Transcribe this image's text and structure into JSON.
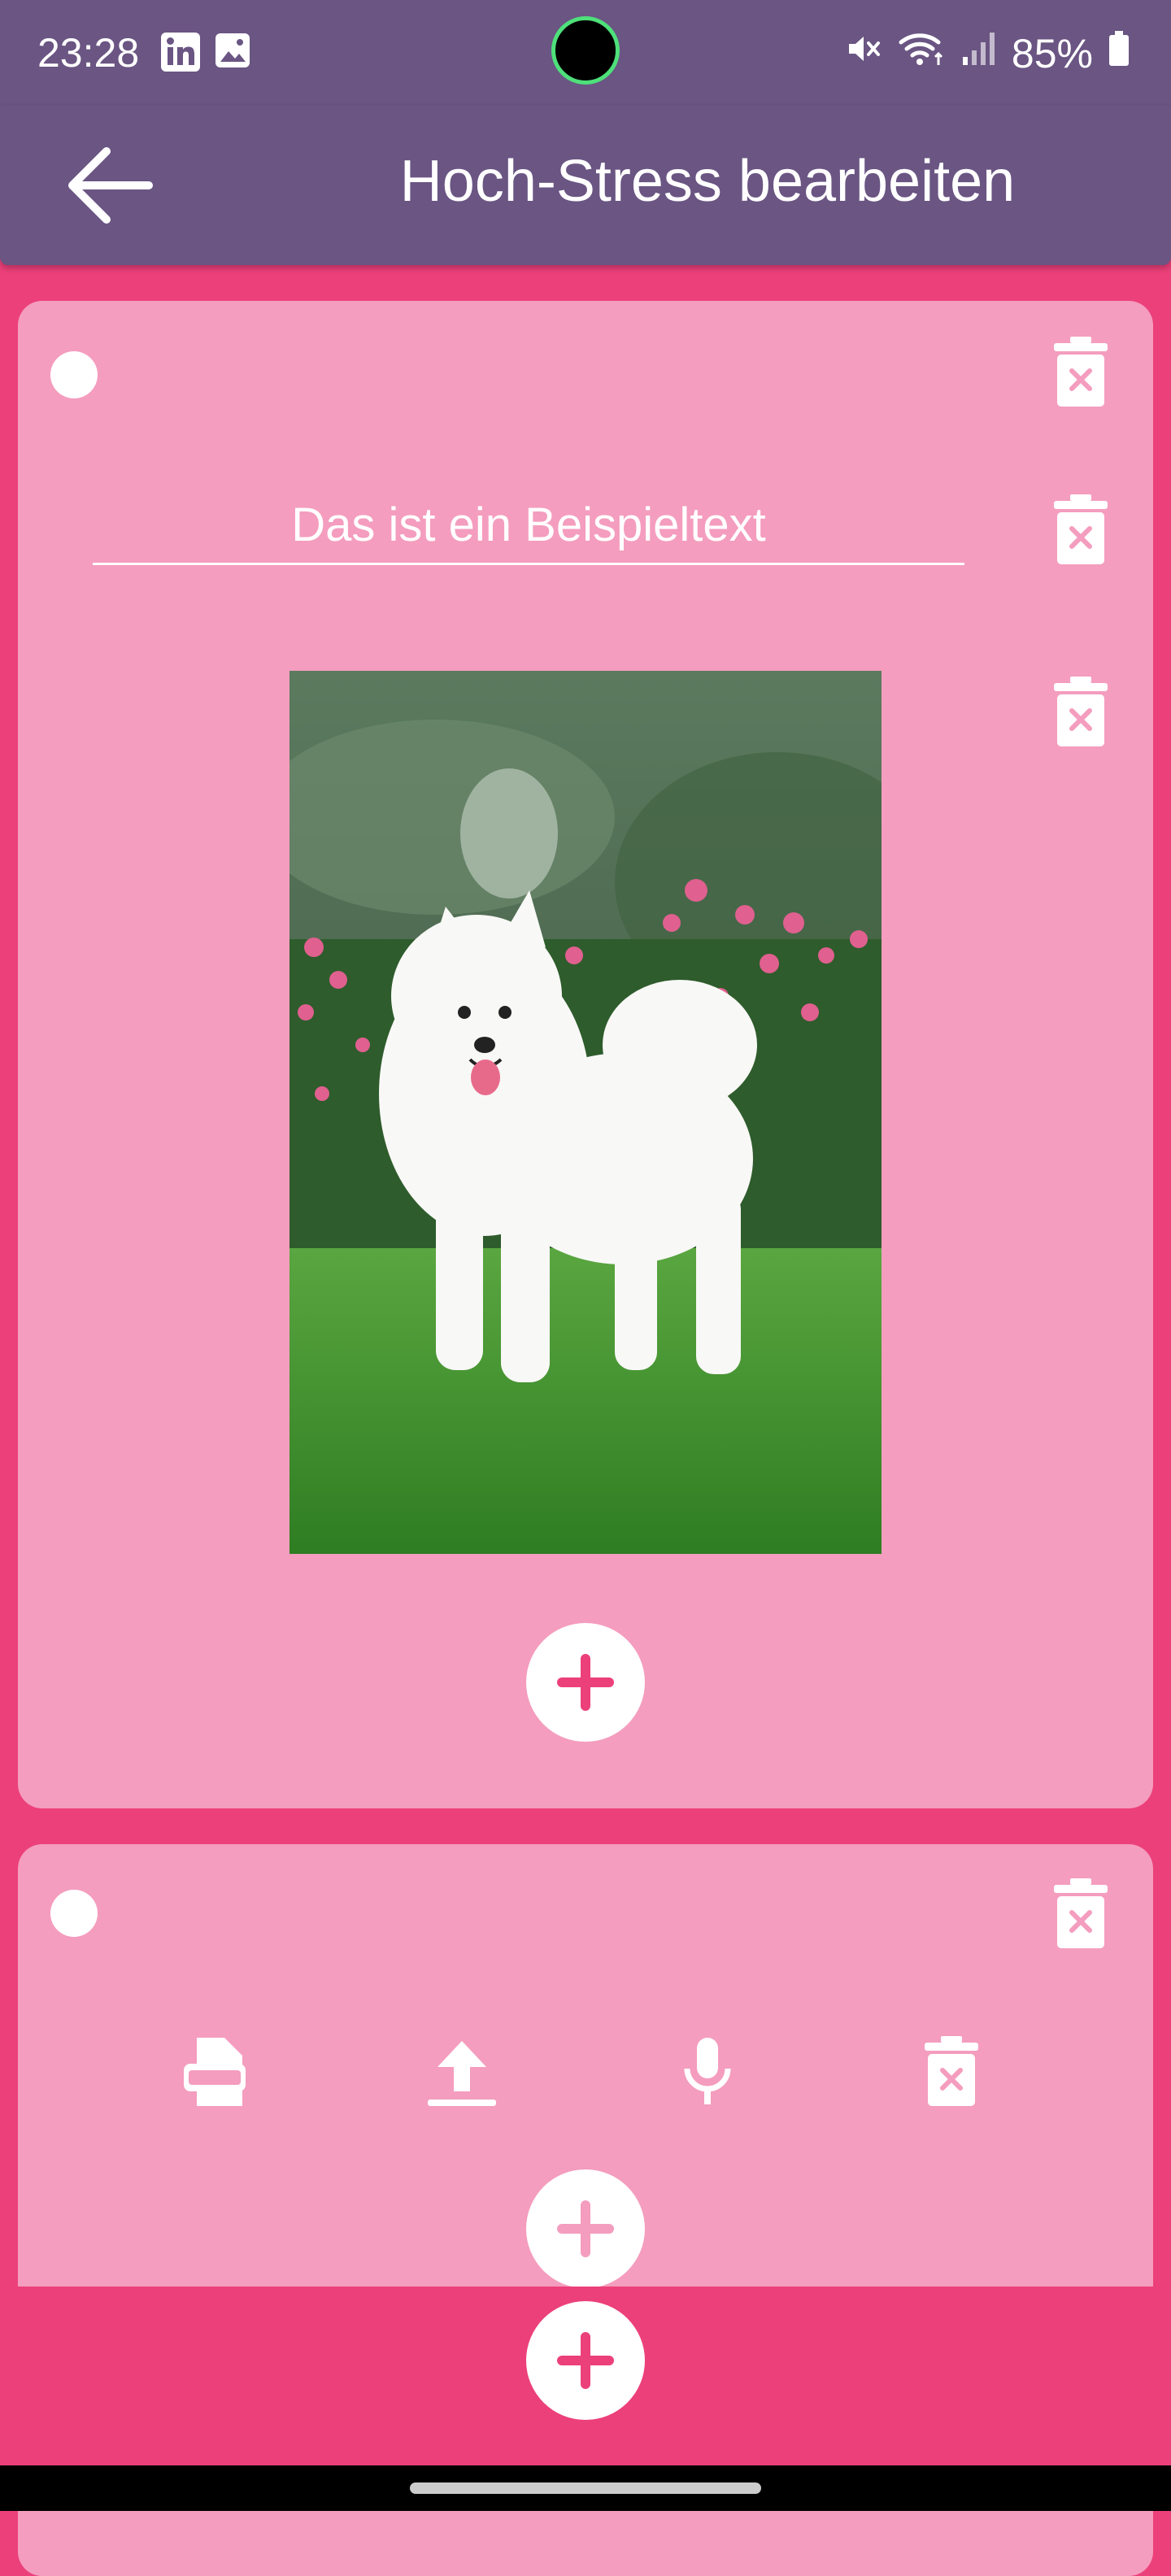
{
  "status": {
    "time": "23:28",
    "battery": "85%",
    "left_icons": [
      "linkedin-icon",
      "gallery-icon"
    ],
    "right_icons": [
      "mute-icon",
      "wifi-icon",
      "signal-icon",
      "battery-icon"
    ]
  },
  "header": {
    "title": "Hoch-Stress bearbeiten",
    "back_icon": "arrow-left-icon"
  },
  "card1": {
    "text_value": "Das ist ein Beispieltext",
    "image_alt": "white-samoyed-dog-photo",
    "add_icon": "plus-icon"
  },
  "card2": {
    "tools": [
      "document-icon",
      "upload-icon",
      "microphone-icon",
      "delete-icon"
    ],
    "add_icon": "plus-icon"
  },
  "footer": {
    "add_icon": "plus-icon"
  },
  "colors": {
    "primary": "#6a5583",
    "accent": "#ec407a",
    "card": "#f49dbe",
    "white": "#ffffff"
  }
}
